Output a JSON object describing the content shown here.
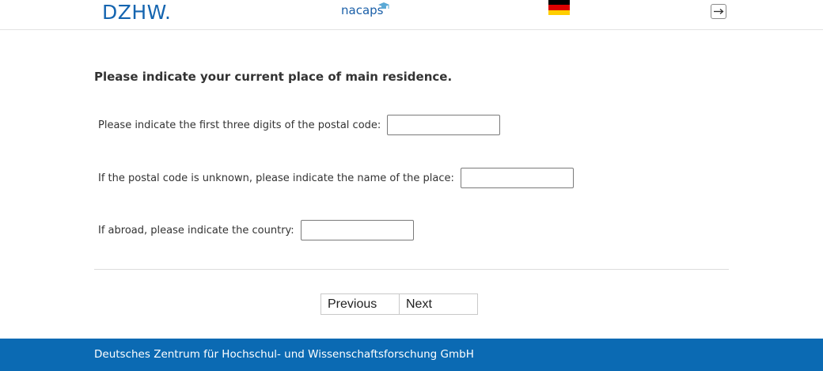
{
  "header": {
    "logo_left": "DZHW.",
    "logo_center": "nacaps",
    "language_flag": "germany-flag",
    "logout_icon": "logout-icon",
    "colors": {
      "brand": "#1565b0",
      "flag": [
        "#000000",
        "#dd0000",
        "#ffce00"
      ]
    }
  },
  "question": "Please indicate your current place of main residence.",
  "fields": [
    {
      "label": "Please indicate the first three digits of the postal code:",
      "value": ""
    },
    {
      "label": "If the postal code is unknown, please indicate the name of the place:",
      "value": ""
    },
    {
      "label": "If abroad, please indicate the country:",
      "value": ""
    }
  ],
  "nav": {
    "previous": "Previous",
    "next": "Next"
  },
  "footer": {
    "text": "Deutsches Zentrum für Hochschul- und Wissenschaftsforschung GmbH",
    "color": "#0b6ab3"
  }
}
